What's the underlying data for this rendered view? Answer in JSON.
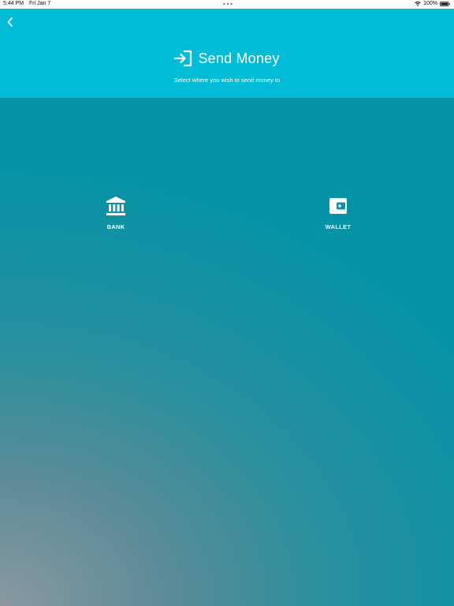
{
  "status_bar": {
    "time": "5:44 PM",
    "date": "Fri Jan 7",
    "battery": "100%",
    "icons": [
      "wifi-icon",
      "battery-icon",
      "more-dots-icon"
    ]
  },
  "header": {
    "back_icon": "chevron-left-icon",
    "title_icon": "send-arrow-icon",
    "title": "Send Money",
    "subtitle": "Select where you wish to send money to"
  },
  "options": [
    {
      "icon": "bank-icon",
      "label": "BANK"
    },
    {
      "icon": "wallet-icon",
      "label": "WALLET"
    }
  ],
  "colors": {
    "header_bg": "#00bcd6",
    "body_bg": "#0593a6",
    "gradient_corner": "#8a98a0",
    "text": "#ffffff"
  }
}
